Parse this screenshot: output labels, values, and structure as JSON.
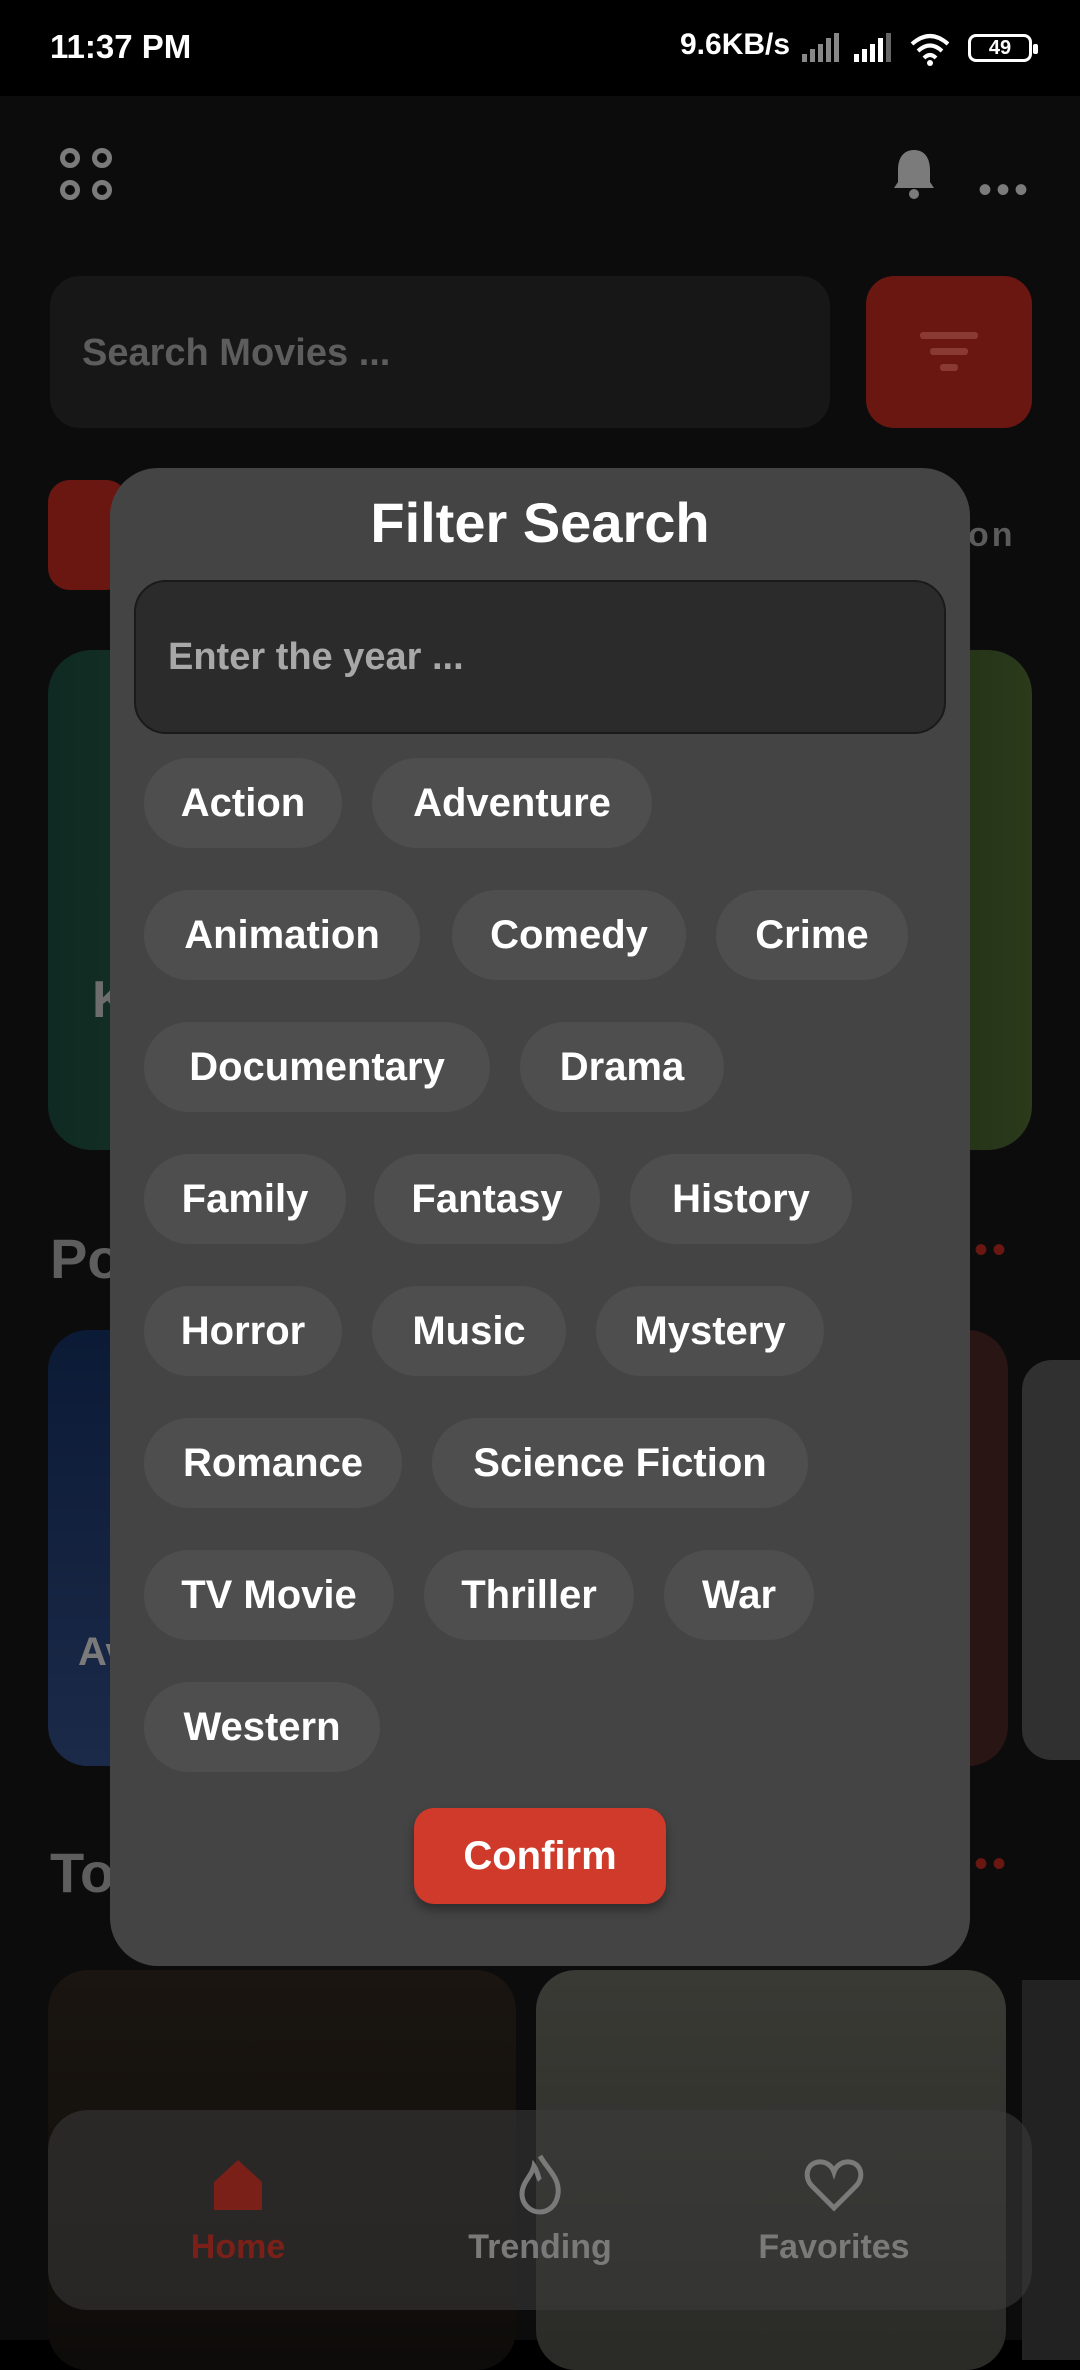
{
  "status_bar": {
    "time": "11:37 PM",
    "net_speed": "9.6KB/s",
    "battery": "49"
  },
  "underlay": {
    "search_placeholder": "Search Movies ...",
    "right_label_fragment": "on",
    "hero_title_fragment": "K",
    "section_popular_fragment": "Po",
    "popular_card_fragment": "Av",
    "section_top_fragment": "To",
    "nav": {
      "home": "Home",
      "trending": "Trending",
      "favorites": "Favorites"
    }
  },
  "modal": {
    "title": "Filter Search",
    "year_placeholder": "Enter the year ...",
    "genres": [
      "Action",
      "Adventure",
      "Animation",
      "Comedy",
      "Crime",
      "Documentary",
      "Drama",
      "Family",
      "Fantasy",
      "History",
      "Horror",
      "Music",
      "Mystery",
      "Romance",
      "Science Fiction",
      "TV Movie",
      "Thriller",
      "War",
      "Western"
    ],
    "confirm_label": "Confirm"
  },
  "colors": {
    "accent": "#cf3a2b",
    "modal_bg": "#444444",
    "chip_bg": "#4e4e4e"
  }
}
